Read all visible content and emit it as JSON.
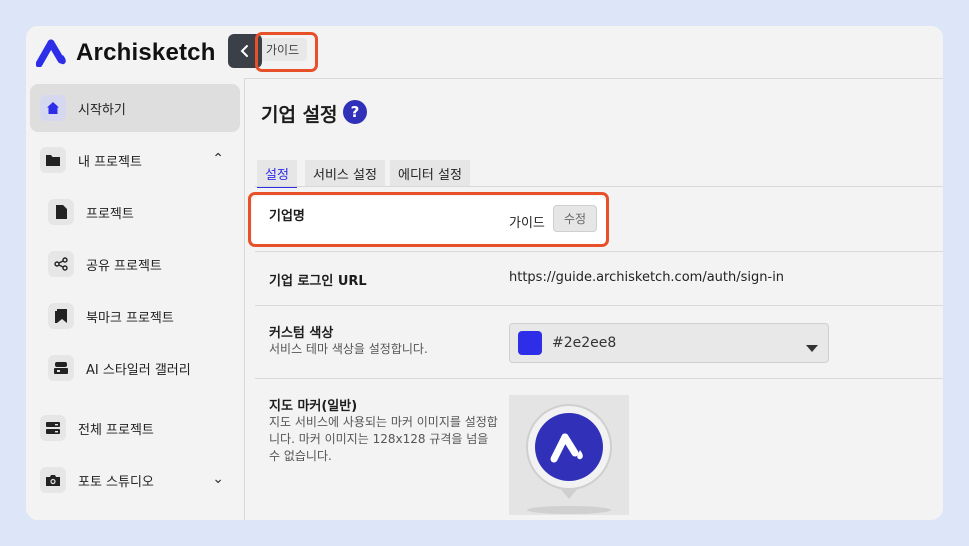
{
  "app": {
    "name": "Archisketch",
    "brand_color": "#2e2ee8"
  },
  "sidebar": {
    "items": [
      {
        "label": "시작하기",
        "icon": "home-icon",
        "active": true
      },
      {
        "label": "내 프로젝트",
        "icon": "folder-icon",
        "expanded": true
      },
      {
        "label": "프로젝트",
        "icon": "file-icon"
      },
      {
        "label": "공유 프로젝트",
        "icon": "share-icon"
      },
      {
        "label": "북마크 프로젝트",
        "icon": "bookmark-icon"
      },
      {
        "label": "AI 스타일러 갤러리",
        "icon": "gallery-icon"
      },
      {
        "label": "전체 프로젝트",
        "icon": "server-icon"
      },
      {
        "label": "포토 스튜디오",
        "icon": "camera-icon",
        "expanded": false
      }
    ]
  },
  "topbar": {
    "breadcrumb": "가이드"
  },
  "page": {
    "title": "기업 설정",
    "help": "?",
    "tabs": [
      {
        "label": "설정",
        "active": true
      },
      {
        "label": "서비스 설정"
      },
      {
        "label": "에디터 설정"
      }
    ],
    "company_name": {
      "label": "기업명",
      "value": "가이드",
      "edit_label": "수정"
    },
    "login_url": {
      "label": "기업 로그인 URL",
      "value": "https://guide.archisketch.com/auth/sign-in"
    },
    "custom_color": {
      "label": "커스텀 색상",
      "description": "서비스 테마 색상을 설정합니다.",
      "value": "#2e2ee8"
    },
    "map_marker": {
      "label": "지도 마커(일반)",
      "description": "지도 서비스에 사용되는 마커 이미지를 설정합니다. 마커 이미지는 128x128 규격을 넘을 수 없습니다."
    }
  }
}
